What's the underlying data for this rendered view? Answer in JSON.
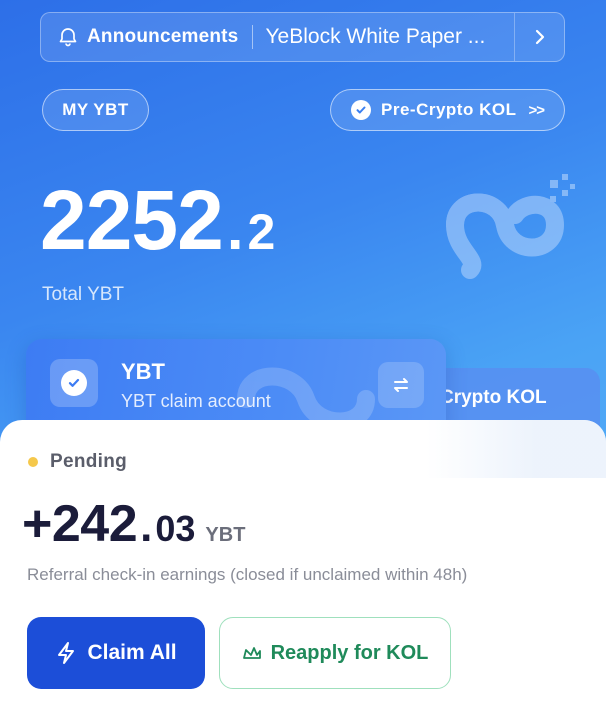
{
  "announcement": {
    "label": "Announcements",
    "message": "YeBlock White Paper ..."
  },
  "pills": {
    "my_ybt": "MY YBT",
    "kol": "Pre-Crypto KOL"
  },
  "balance": {
    "integer": "2252",
    "decimal": "2",
    "label": "Total YBT"
  },
  "cards": {
    "front": {
      "title": "YBT",
      "subtitle": "YBT claim account"
    },
    "back": {
      "title": "Crypto KOL"
    }
  },
  "pending": {
    "status": "Pending",
    "amount_integer": "+242",
    "amount_decimal": "03",
    "unit": "YBT",
    "description": "Referral check-in earnings (closed if unclaimed within 48h)"
  },
  "buttons": {
    "claim_all": "Claim All",
    "reapply": "Reapply for KOL"
  },
  "colors": {
    "primary": "#1c4ed8",
    "pending_dot": "#f5c84b",
    "reapply_text": "#1f8a5a"
  }
}
